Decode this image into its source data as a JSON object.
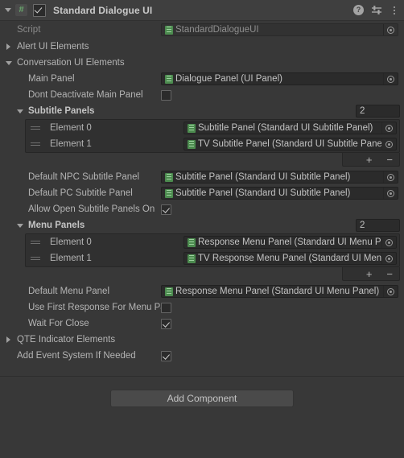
{
  "header": {
    "title": "Standard Dialogue UI",
    "enabled_checkbox": true,
    "script_icon": "script-hash-icon",
    "help_icon": "?",
    "preset_icon": "preset-sliders-icon",
    "menu_icon": "kebab-menu-icon"
  },
  "script_row": {
    "label": "Script",
    "value": "StandardDialogueUI"
  },
  "sections": {
    "alert": {
      "label": "Alert UI Elements",
      "expanded": false
    },
    "conversation": {
      "label": "Conversation UI Elements",
      "expanded": true
    },
    "qte": {
      "label": "QTE Indicator Elements",
      "expanded": false
    }
  },
  "conversation": {
    "main_panel": {
      "label": "Main Panel",
      "value": "Dialogue Panel (UI Panel)"
    },
    "dont_deactivate": {
      "label": "Dont Deactivate Main Panel",
      "checked": false
    },
    "subtitle_panels": {
      "label": "Subtitle Panels",
      "size": "2",
      "expanded": true,
      "elements": [
        {
          "label": "Element 0",
          "value": "Subtitle Panel (Standard UI Subtitle Panel)"
        },
        {
          "label": "Element 1",
          "value": "TV Subtitle Panel (Standard UI Subtitle Panel)"
        }
      ],
      "add_label": "+",
      "remove_label": "−"
    },
    "default_npc_subtitle_panel": {
      "label": "Default NPC Subtitle Panel",
      "value": "Subtitle Panel (Standard UI Subtitle Panel)"
    },
    "default_pc_subtitle_panel": {
      "label": "Default PC Subtitle Panel",
      "value": "Subtitle Panel (Standard UI Subtitle Panel)"
    },
    "allow_open_subtitle_panels": {
      "label": "Allow Open Subtitle Panels On",
      "checked": true
    },
    "menu_panels": {
      "label": "Menu Panels",
      "size": "2",
      "expanded": true,
      "elements": [
        {
          "label": "Element 0",
          "value": "Response Menu Panel (Standard UI Menu Panel)"
        },
        {
          "label": "Element 1",
          "value": "TV Response Menu Panel (Standard UI Menu Panel)"
        }
      ],
      "add_label": "+",
      "remove_label": "−"
    },
    "default_menu_panel": {
      "label": "Default Menu Panel",
      "value": "Response Menu Panel (Standard UI Menu Panel)"
    },
    "use_first_response": {
      "label": "Use First Response For Menu Panel",
      "checked": false
    },
    "wait_for_close": {
      "label": "Wait For Close",
      "checked": true
    }
  },
  "add_event_system": {
    "label": "Add Event System If Needed",
    "checked": true
  },
  "footer": {
    "add_component_label": "Add Component"
  },
  "colors": {
    "background": "#383838",
    "header_background": "#3f3f3f",
    "field_background": "#2b2b2b",
    "list_background": "#303030",
    "text": "#b8b8b8",
    "script_icon_green": "#4c8b4f"
  }
}
